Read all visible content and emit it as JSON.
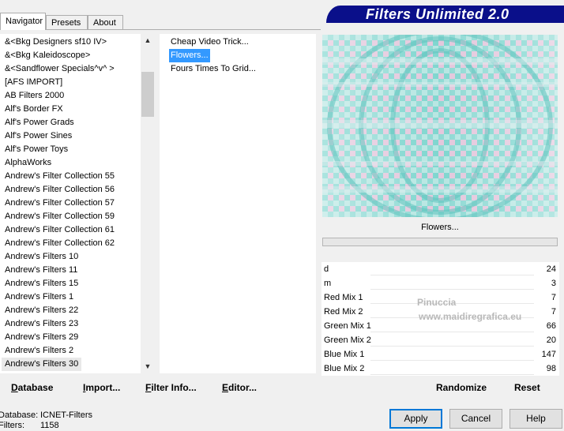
{
  "tabs": [
    {
      "label": "Navigator",
      "active": true
    },
    {
      "label": "Presets",
      "active": false
    },
    {
      "label": "About",
      "active": false
    }
  ],
  "logo_text": "Filters Unlimited 2.0",
  "categories": [
    "&<Bkg Designers sf10 IV>",
    "&<Bkg Kaleidoscope>",
    "&<Sandflower Specials^v^ >",
    "[AFS IMPORT]",
    "AB Filters 2000",
    "Alf's Border FX",
    "Alf's Power Grads",
    "Alf's Power Sines",
    "Alf's Power Toys",
    "AlphaWorks",
    "Andrew's Filter Collection 55",
    "Andrew's Filter Collection 56",
    "Andrew's Filter Collection 57",
    "Andrew's Filter Collection 59",
    "Andrew's Filter Collection 61",
    "Andrew's Filter Collection 62",
    "Andrew's Filters 10",
    "Andrew's Filters 11",
    "Andrew's Filters 15",
    "Andrew's Filters 1",
    "Andrew's Filters 22",
    "Andrew's Filters 23",
    "Andrew's Filters 29",
    "Andrew's Filters 2",
    "Andrew's Filters 30"
  ],
  "selected_category": "Andrew's Filters 30",
  "filters": [
    "Cheap Video Trick...",
    "Flowers...",
    "Fours Times To Grid..."
  ],
  "selected_filter": "Flowers...",
  "preview_label": "Flowers...",
  "params": [
    {
      "name": "d",
      "value": "24"
    },
    {
      "name": "m",
      "value": "3"
    },
    {
      "name": "Red Mix 1",
      "value": "7"
    },
    {
      "name": "Red Mix 2",
      "value": "7"
    },
    {
      "name": "Green Mix 1",
      "value": "66"
    },
    {
      "name": "Green Mix 2",
      "value": "20"
    },
    {
      "name": "Blue Mix 1",
      "value": "147"
    },
    {
      "name": "Blue Mix 2",
      "value": "98"
    }
  ],
  "links": {
    "database": "Database",
    "import": "Import...",
    "filter_info": "Filter Info...",
    "editor": "Editor...",
    "randomize": "Randomize",
    "reset": "Reset"
  },
  "buttons": {
    "apply": "Apply",
    "cancel": "Cancel",
    "help": "Help"
  },
  "status": {
    "database_label": "Database:",
    "database_value": "ICNET-Filters",
    "filters_label": "Filters:",
    "filters_value": "1158"
  },
  "watermark": {
    "line1": "Pinuccia",
    "line2": "www.maidiregrafica.eu"
  },
  "colors": {
    "logo_bg": "#0a0f8a",
    "selection": "#3399ff",
    "preview_teal": "#6ecfc9",
    "preview_pink": "#e9c4dc"
  }
}
